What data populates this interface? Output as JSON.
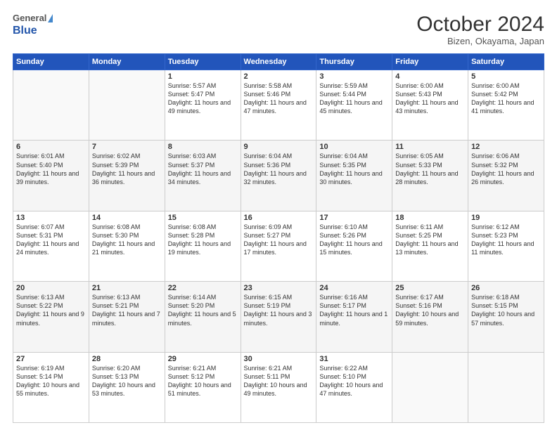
{
  "header": {
    "logo_general": "General",
    "logo_blue": "Blue",
    "month_title": "October 2024",
    "location": "Bizen, Okayama, Japan"
  },
  "days_of_week": [
    "Sunday",
    "Monday",
    "Tuesday",
    "Wednesday",
    "Thursday",
    "Friday",
    "Saturday"
  ],
  "weeks": [
    [
      {
        "day": "",
        "info": ""
      },
      {
        "day": "",
        "info": ""
      },
      {
        "day": "1",
        "info": "Sunrise: 5:57 AM\nSunset: 5:47 PM\nDaylight: 11 hours and 49 minutes."
      },
      {
        "day": "2",
        "info": "Sunrise: 5:58 AM\nSunset: 5:46 PM\nDaylight: 11 hours and 47 minutes."
      },
      {
        "day": "3",
        "info": "Sunrise: 5:59 AM\nSunset: 5:44 PM\nDaylight: 11 hours and 45 minutes."
      },
      {
        "day": "4",
        "info": "Sunrise: 6:00 AM\nSunset: 5:43 PM\nDaylight: 11 hours and 43 minutes."
      },
      {
        "day": "5",
        "info": "Sunrise: 6:00 AM\nSunset: 5:42 PM\nDaylight: 11 hours and 41 minutes."
      }
    ],
    [
      {
        "day": "6",
        "info": "Sunrise: 6:01 AM\nSunset: 5:40 PM\nDaylight: 11 hours and 39 minutes."
      },
      {
        "day": "7",
        "info": "Sunrise: 6:02 AM\nSunset: 5:39 PM\nDaylight: 11 hours and 36 minutes."
      },
      {
        "day": "8",
        "info": "Sunrise: 6:03 AM\nSunset: 5:37 PM\nDaylight: 11 hours and 34 minutes."
      },
      {
        "day": "9",
        "info": "Sunrise: 6:04 AM\nSunset: 5:36 PM\nDaylight: 11 hours and 32 minutes."
      },
      {
        "day": "10",
        "info": "Sunrise: 6:04 AM\nSunset: 5:35 PM\nDaylight: 11 hours and 30 minutes."
      },
      {
        "day": "11",
        "info": "Sunrise: 6:05 AM\nSunset: 5:33 PM\nDaylight: 11 hours and 28 minutes."
      },
      {
        "day": "12",
        "info": "Sunrise: 6:06 AM\nSunset: 5:32 PM\nDaylight: 11 hours and 26 minutes."
      }
    ],
    [
      {
        "day": "13",
        "info": "Sunrise: 6:07 AM\nSunset: 5:31 PM\nDaylight: 11 hours and 24 minutes."
      },
      {
        "day": "14",
        "info": "Sunrise: 6:08 AM\nSunset: 5:30 PM\nDaylight: 11 hours and 21 minutes."
      },
      {
        "day": "15",
        "info": "Sunrise: 6:08 AM\nSunset: 5:28 PM\nDaylight: 11 hours and 19 minutes."
      },
      {
        "day": "16",
        "info": "Sunrise: 6:09 AM\nSunset: 5:27 PM\nDaylight: 11 hours and 17 minutes."
      },
      {
        "day": "17",
        "info": "Sunrise: 6:10 AM\nSunset: 5:26 PM\nDaylight: 11 hours and 15 minutes."
      },
      {
        "day": "18",
        "info": "Sunrise: 6:11 AM\nSunset: 5:25 PM\nDaylight: 11 hours and 13 minutes."
      },
      {
        "day": "19",
        "info": "Sunrise: 6:12 AM\nSunset: 5:23 PM\nDaylight: 11 hours and 11 minutes."
      }
    ],
    [
      {
        "day": "20",
        "info": "Sunrise: 6:13 AM\nSunset: 5:22 PM\nDaylight: 11 hours and 9 minutes."
      },
      {
        "day": "21",
        "info": "Sunrise: 6:13 AM\nSunset: 5:21 PM\nDaylight: 11 hours and 7 minutes."
      },
      {
        "day": "22",
        "info": "Sunrise: 6:14 AM\nSunset: 5:20 PM\nDaylight: 11 hours and 5 minutes."
      },
      {
        "day": "23",
        "info": "Sunrise: 6:15 AM\nSunset: 5:19 PM\nDaylight: 11 hours and 3 minutes."
      },
      {
        "day": "24",
        "info": "Sunrise: 6:16 AM\nSunset: 5:17 PM\nDaylight: 11 hours and 1 minute."
      },
      {
        "day": "25",
        "info": "Sunrise: 6:17 AM\nSunset: 5:16 PM\nDaylight: 10 hours and 59 minutes."
      },
      {
        "day": "26",
        "info": "Sunrise: 6:18 AM\nSunset: 5:15 PM\nDaylight: 10 hours and 57 minutes."
      }
    ],
    [
      {
        "day": "27",
        "info": "Sunrise: 6:19 AM\nSunset: 5:14 PM\nDaylight: 10 hours and 55 minutes."
      },
      {
        "day": "28",
        "info": "Sunrise: 6:20 AM\nSunset: 5:13 PM\nDaylight: 10 hours and 53 minutes."
      },
      {
        "day": "29",
        "info": "Sunrise: 6:21 AM\nSunset: 5:12 PM\nDaylight: 10 hours and 51 minutes."
      },
      {
        "day": "30",
        "info": "Sunrise: 6:21 AM\nSunset: 5:11 PM\nDaylight: 10 hours and 49 minutes."
      },
      {
        "day": "31",
        "info": "Sunrise: 6:22 AM\nSunset: 5:10 PM\nDaylight: 10 hours and 47 minutes."
      },
      {
        "day": "",
        "info": ""
      },
      {
        "day": "",
        "info": ""
      }
    ]
  ]
}
